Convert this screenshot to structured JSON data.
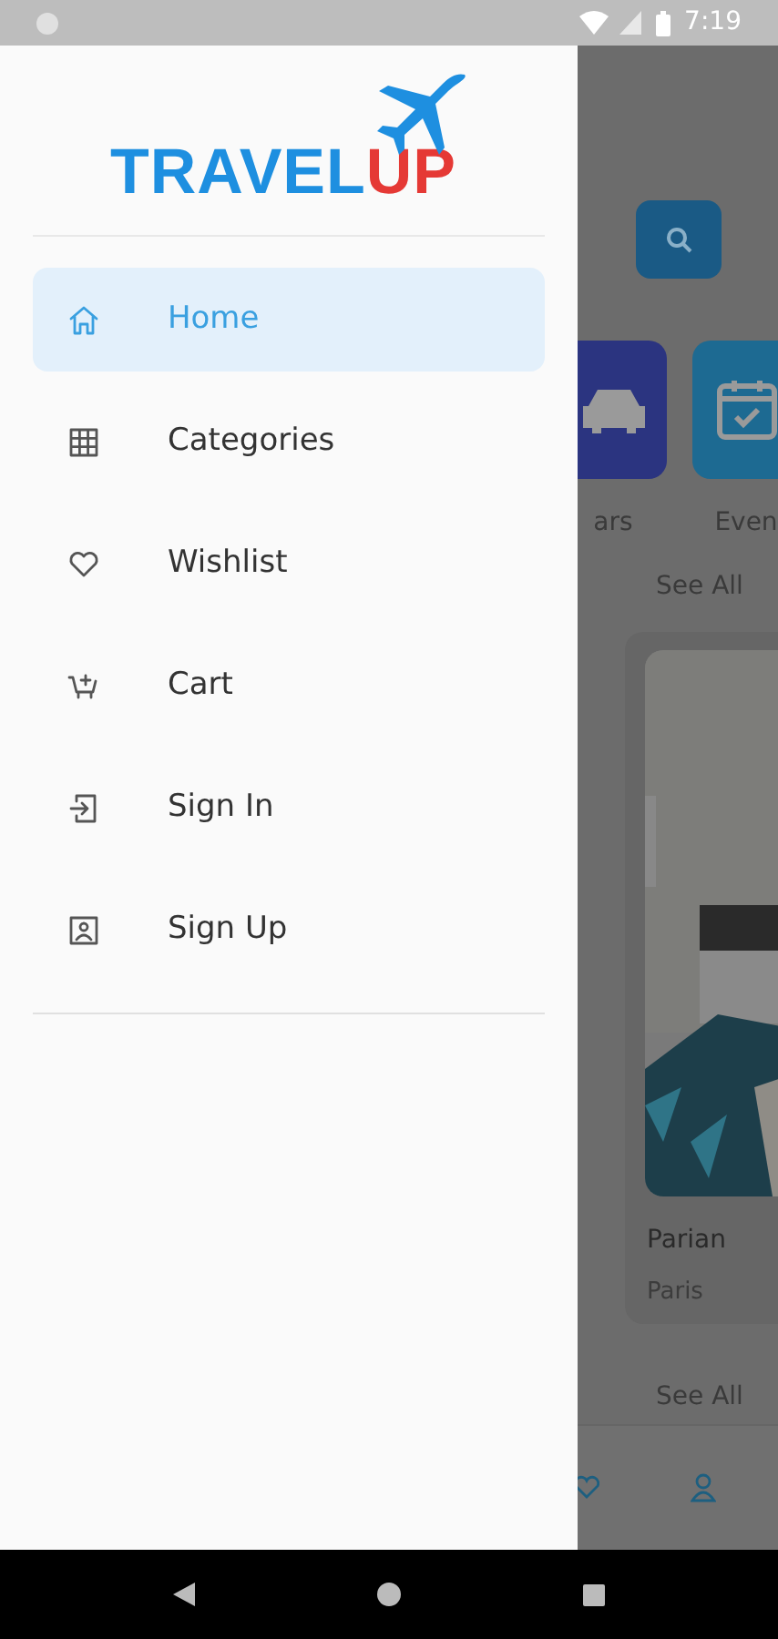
{
  "status_bar": {
    "time": "7:19"
  },
  "drawer": {
    "logo": {
      "primary": "TRAVEL",
      "accent": "UP"
    },
    "items": [
      {
        "label": "Home",
        "selected": true
      },
      {
        "label": "Categories",
        "selected": false
      },
      {
        "label": "Wishlist",
        "selected": false
      },
      {
        "label": "Cart",
        "selected": false
      },
      {
        "label": "Sign In",
        "selected": false
      },
      {
        "label": "Sign Up",
        "selected": false
      }
    ]
  },
  "background": {
    "categories": [
      {
        "label": "ars"
      },
      {
        "label": "Even"
      }
    ],
    "see_all_top": "See All",
    "card": {
      "title": "Parian",
      "location": "Paris"
    },
    "see_all_bottom": "See All"
  }
}
